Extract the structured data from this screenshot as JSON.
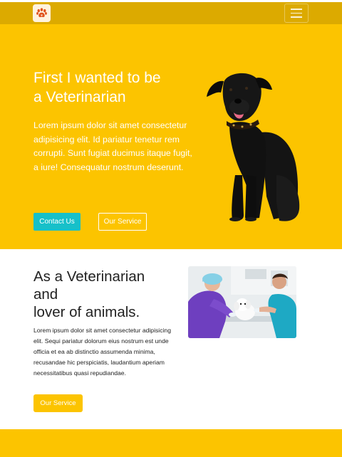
{
  "navbar": {
    "logo_icon": "paw-icon",
    "menu_icon": "hamburger-menu-icon",
    "color": "#dcaa00"
  },
  "hero": {
    "title_line1": "First I wanted to be",
    "title_line2": "a Veterinarian",
    "text": "Lorem ipsum dolor sit amet consectetur adipisicing elit. Id pariatur tenetur rem corrupti. Sunt fugiat ducimus itaque fugit, a iure! Consequatur nostrum deserunt.",
    "contact_label": "Contact Us",
    "service_label": "Our Service",
    "background": "#fcc400",
    "contact_color": "#17c0c9"
  },
  "about": {
    "title_line1": "As a Veterinarian",
    "title_line2": "and",
    "title_line3": "lover of animals.",
    "text": "Lorem ipsum dolor sit amet consectetur adipisicing elit. Sequi pariatur dolorum eius nostrum est unde officia et ea ab distinctio assumenda minima, recusandae hic perspiciatis, laudantium aperiam necessitatibus quasi repudiandae.",
    "service_label": "Our Service"
  }
}
